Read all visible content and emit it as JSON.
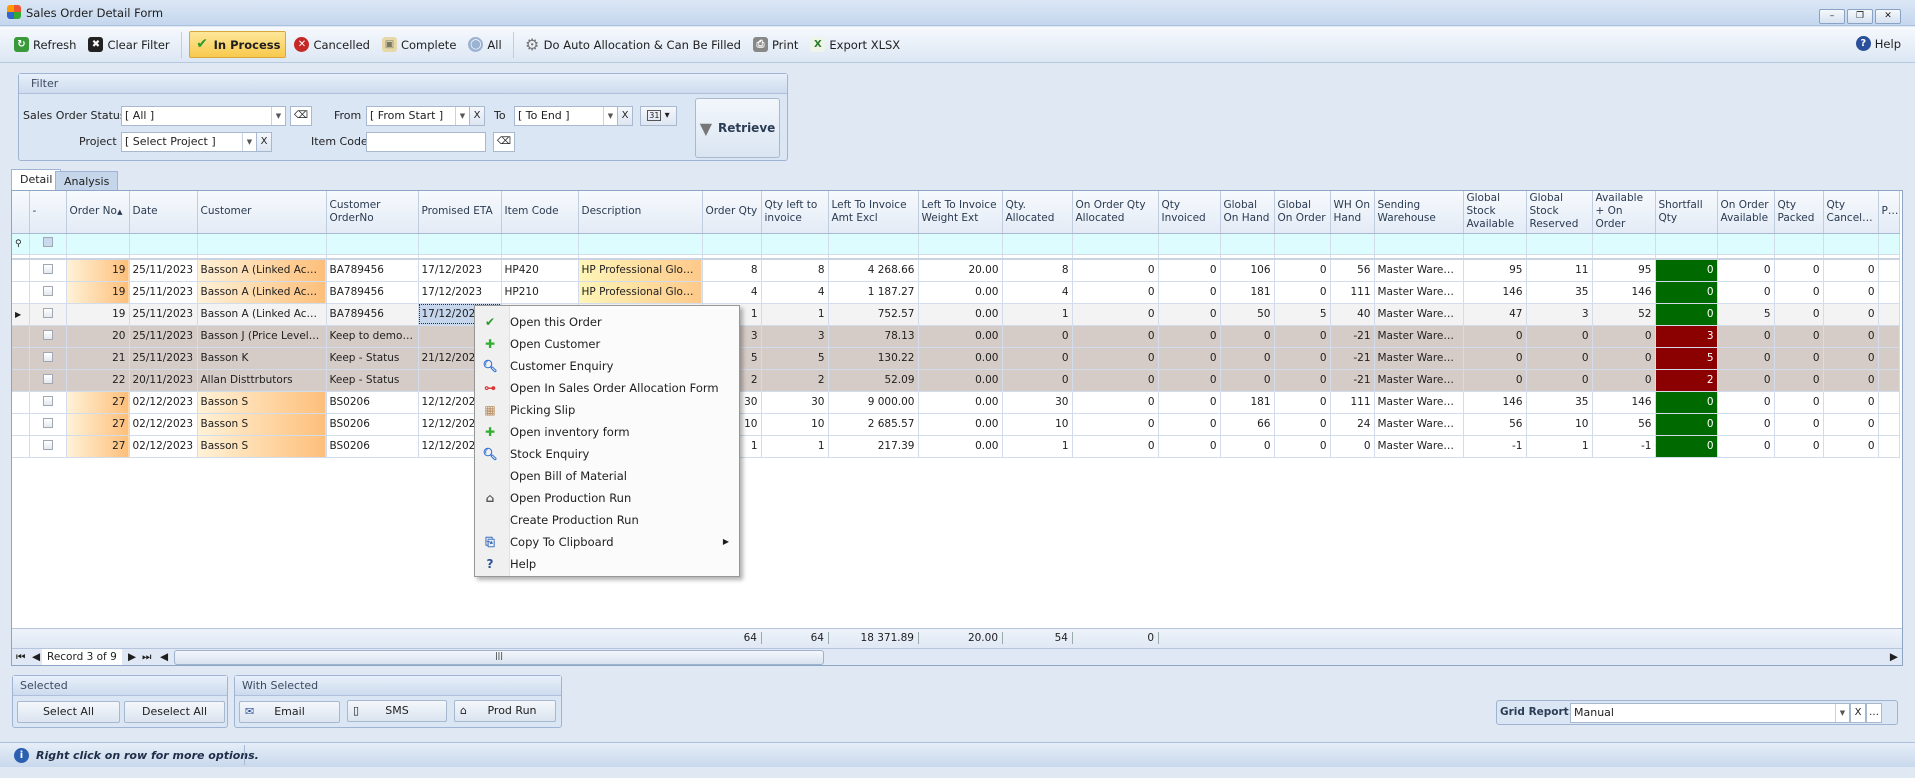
{
  "window": {
    "title": "Sales Order Detail Form",
    "controls": [
      "minimize",
      "restore",
      "close"
    ]
  },
  "toolbar": {
    "items": [
      {
        "label": "Refresh",
        "icon": "refresh-icon"
      },
      {
        "label": "Clear Filter",
        "icon": "clear-filter-icon"
      },
      {
        "label": "In Process",
        "icon": "checkmark-icon",
        "active": true
      },
      {
        "label": "Cancelled",
        "icon": "cancel-icon"
      },
      {
        "label": "Complete",
        "icon": "complete-icon"
      },
      {
        "label": "All",
        "icon": "globe-icon"
      },
      {
        "label": "Do Auto Allocation & Can Be Filled",
        "icon": "gear-icon"
      },
      {
        "label": "Print",
        "icon": "printer-icon"
      },
      {
        "label": "Export XLSX",
        "icon": "excel-icon"
      }
    ],
    "help": "Help"
  },
  "filter": {
    "title": "Filter",
    "status_label": "Sales Order Status",
    "status_value": "[ All ]",
    "from_label": "From",
    "from_value": "[ From Start ]",
    "to_label": "To",
    "to_value": "[ To End ]",
    "project_label": "Project",
    "project_value": "[ Select Project ]",
    "item_code_label": "Item Code",
    "item_code_value": "",
    "retrieve": "Retrieve",
    "calendar": "31"
  },
  "tabs": [
    "Detail",
    "Analysis"
  ],
  "grid": {
    "columns": [
      "-",
      "Order No.",
      "Date",
      "Customer",
      "Customer OrderNo",
      "Promised ETA",
      "Item Code",
      "Description",
      "Order Qty",
      "Qty left to invoice",
      "Left To Invoice Amt Excl",
      "Left To Invoice Weight Ext",
      "Qty. Allocated",
      "On Order Qty Allocated",
      "Qty Invoiced",
      "Global On Hand",
      "Global On Order",
      "WH On Hand",
      "Sending Warehouse",
      "Global Stock Available",
      "Global Stock Reserved",
      "Available + On Order",
      "Shortfall Qty",
      "On Order Available",
      "Qty Packed",
      "Qty Cancelled",
      "PO"
    ],
    "sort_column": "Order No.",
    "rows": [
      {
        "status": "normal",
        "cells": [
          "19",
          "25/11/2023",
          "Basson A (Linked Acco...",
          "BA789456",
          "17/12/2023",
          "HP420",
          "HP Professional Gloss...",
          "8",
          "8",
          "4 268.66",
          "20.00",
          "8",
          "0",
          "0",
          "106",
          "0",
          "56",
          "Master Wareh...",
          "95",
          "11",
          "95",
          "0",
          "0",
          "0",
          "0",
          ""
        ]
      },
      {
        "status": "normal",
        "cells": [
          "19",
          "25/11/2023",
          "Basson A (Linked Acco...",
          "BA789456",
          "17/12/2023",
          "HP210",
          "HP Professional Gloss...",
          "4",
          "4",
          "1 187.27",
          "0.00",
          "4",
          "0",
          "0",
          "181",
          "0",
          "111",
          "Master Wareh...",
          "146",
          "35",
          "146",
          "0",
          "0",
          "0",
          "0",
          ""
        ]
      },
      {
        "status": "selected",
        "cells": [
          "19",
          "25/11/2023",
          "Basson A (Linked Acco...",
          "BA789456",
          "17/12/2023",
          "",
          "",
          "1",
          "1",
          "752.57",
          "0.00",
          "1",
          "0",
          "0",
          "50",
          "5",
          "40",
          "Master Wareh...",
          "47",
          "3",
          "52",
          "0",
          "5",
          "0",
          "0",
          ""
        ]
      },
      {
        "status": "shortfall",
        "cells": [
          "20",
          "25/11/2023",
          "Basson J (Price Level 8...",
          "Keep to demo ...",
          "",
          "",
          "",
          "3",
          "3",
          "78.13",
          "0.00",
          "0",
          "0",
          "0",
          "0",
          "0",
          "-21",
          "Master Wareh...",
          "0",
          "0",
          "0",
          "3",
          "0",
          "0",
          "0",
          ""
        ]
      },
      {
        "status": "shortfall",
        "cells": [
          "21",
          "25/11/2023",
          "Basson K",
          "Keep - Status",
          "21/12/2023",
          "",
          "",
          "5",
          "5",
          "130.22",
          "0.00",
          "0",
          "0",
          "0",
          "0",
          "0",
          "-21",
          "Master Wareh...",
          "0",
          "0",
          "0",
          "5",
          "0",
          "0",
          "0",
          ""
        ]
      },
      {
        "status": "shortfall",
        "cells": [
          "22",
          "20/11/2023",
          "Allan Disttrbutors",
          "Keep - Status",
          "",
          "",
          "",
          "2",
          "2",
          "52.09",
          "0.00",
          "0",
          "0",
          "0",
          "0",
          "0",
          "-21",
          "Master Wareh...",
          "0",
          "0",
          "0",
          "2",
          "0",
          "0",
          "0",
          ""
        ]
      },
      {
        "status": "normal",
        "cells": [
          "27",
          "02/12/2023",
          "Basson S",
          "BS0206",
          "12/12/2023",
          "",
          "",
          "30",
          "30",
          "9 000.00",
          "0.00",
          "30",
          "0",
          "0",
          "181",
          "0",
          "111",
          "Master Wareh...",
          "146",
          "35",
          "146",
          "0",
          "0",
          "0",
          "0",
          ""
        ]
      },
      {
        "status": "normal",
        "cells": [
          "27",
          "02/12/2023",
          "Basson S",
          "BS0206",
          "12/12/2023",
          "",
          "",
          "10",
          "10",
          "2 685.57",
          "0.00",
          "10",
          "0",
          "0",
          "66",
          "0",
          "24",
          "Master Wareh...",
          "56",
          "10",
          "56",
          "0",
          "0",
          "0",
          "0",
          ""
        ]
      },
      {
        "status": "normal",
        "cells": [
          "27",
          "02/12/2023",
          "Basson S",
          "BS0206",
          "12/12/2023",
          "",
          "",
          "1",
          "1",
          "217.39",
          "0.00",
          "1",
          "0",
          "0",
          "0",
          "0",
          "0",
          "Master Wareh...",
          "-1",
          "1",
          "-1",
          "0",
          "0",
          "0",
          "0",
          ""
        ]
      }
    ],
    "totals": {
      "order_qty": "64",
      "qty_left": "64",
      "left_amt": "18 371.89",
      "left_weight": "20.00",
      "qty_allocated": "54",
      "on_order_allocated": "0"
    },
    "record_nav": "Record 3 of 9"
  },
  "context_menu": [
    {
      "label": "Open this Order",
      "icon": "check-icon"
    },
    {
      "label": "Open Customer",
      "icon": "plus-icon"
    },
    {
      "label": "Customer Enquiry",
      "icon": "magnifier-icon"
    },
    {
      "label": "Open In Sales Order Allocation Form",
      "icon": "allocation-icon"
    },
    {
      "label": "Picking Slip",
      "icon": "box-icon"
    },
    {
      "label": "Open inventory form",
      "icon": "plus-icon"
    },
    {
      "label": "Stock Enquiry",
      "icon": "magnifier-icon"
    },
    {
      "label": "Open Bill of Material",
      "icon": ""
    },
    {
      "label": "Open Production Run",
      "icon": "production-icon"
    },
    {
      "label": "Create Production Run",
      "icon": ""
    },
    {
      "label": "Copy To Clipboard",
      "icon": "clipboard-icon",
      "submenu": true
    },
    {
      "label": "Help",
      "icon": "help-icon"
    }
  ],
  "selected_group": {
    "title": "Selected",
    "select_all": "Select All",
    "deselect_all": "Deselect All"
  },
  "with_selected_group": {
    "title": "With Selected",
    "email": "Email",
    "sms": "SMS",
    "prod_run": "Prod Run"
  },
  "grid_report": {
    "label": "Grid Report:",
    "value": "Manual"
  },
  "status_bar": {
    "message": "Right click on row for more options."
  },
  "colors": {
    "shortfall_ok": "#006a00",
    "shortfall_short": "#8b0000",
    "shortfall_row": "#d6ccc7",
    "active_filter": "#f8c94c"
  }
}
